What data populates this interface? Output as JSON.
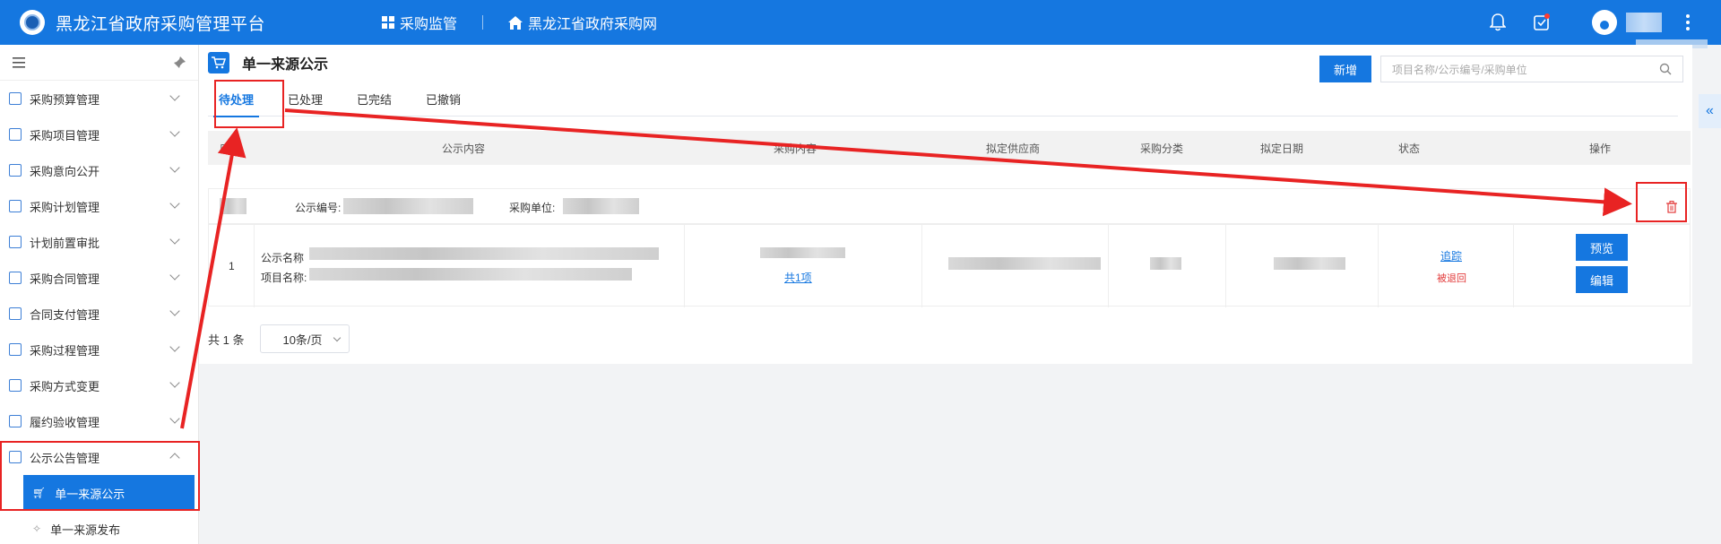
{
  "header": {
    "app_title": "黑龙江省政府采购管理平台",
    "nav": [
      {
        "label": "采购监管",
        "icon": "grid-icon"
      },
      {
        "label": "黑龙江省政府采购网",
        "icon": "home-icon"
      }
    ]
  },
  "sidebar": {
    "items": [
      {
        "label": "采购预算管理"
      },
      {
        "label": "采购项目管理"
      },
      {
        "label": "采购意向公开"
      },
      {
        "label": "采购计划管理"
      },
      {
        "label": "计划前置审批"
      },
      {
        "label": "采购合同管理"
      },
      {
        "label": "合同支付管理"
      },
      {
        "label": "采购过程管理"
      },
      {
        "label": "采购方式变更"
      },
      {
        "label": "履约验收管理"
      },
      {
        "label": "公示公告管理"
      }
    ],
    "sub_items": [
      {
        "label": "单一来源公示"
      },
      {
        "label": "单一来源发布"
      }
    ]
  },
  "page": {
    "title": "单一来源公示",
    "add_label": "新增",
    "search_placeholder": "项目名称/公示编号/采购单位",
    "tabs": [
      "待处理",
      "已处理",
      "已完结",
      "已撤销"
    ],
    "active_tab": 0
  },
  "table": {
    "columns": [
      "序号",
      "公示内容",
      "采购内容",
      "拟定供应商",
      "采购分类",
      "拟定日期",
      "状态",
      "操作"
    ],
    "group": {
      "code_label": "公示编号:",
      "unit_label": "采购单位:"
    },
    "row": {
      "index": "1",
      "name_label": "公示名称",
      "project_label": "项目名称:",
      "items_link": "共1项",
      "track_link": "追踪",
      "status": "被退回",
      "preview_label": "预览",
      "edit_label": "编辑"
    }
  },
  "pager": {
    "total_text": "共 1 条",
    "page_size": "10条/页"
  },
  "colors": {
    "primary": "#1577e0",
    "annotation": "#e82323",
    "status_red": "#e23b3b"
  }
}
